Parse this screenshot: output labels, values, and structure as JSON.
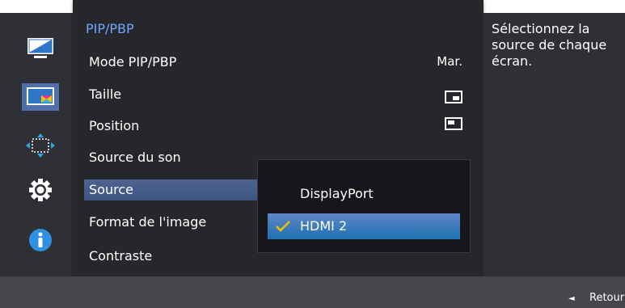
{
  "sidebar": {
    "icons": [
      {
        "name": "monitor-icon"
      },
      {
        "name": "picture-in-picture-icon",
        "selected": true
      },
      {
        "name": "move-arrows-icon"
      },
      {
        "name": "gear-icon"
      },
      {
        "name": "info-icon"
      }
    ]
  },
  "menu": {
    "title": "PIP/PBP",
    "items": [
      {
        "label": "Mode PIP/PBP",
        "value": "Mar."
      },
      {
        "label": "Taille",
        "value_icon": "size-small-icon"
      },
      {
        "label": "Position",
        "value_icon": "position-topleft-icon"
      },
      {
        "label": "Source du son"
      },
      {
        "label": "Source",
        "highlighted": true
      },
      {
        "label": "Format de l'image"
      },
      {
        "label": "Contraste"
      }
    ]
  },
  "dropdown": {
    "options": [
      {
        "label": "DisplayPort"
      },
      {
        "label": "HDMI 2",
        "selected": true
      }
    ]
  },
  "help": {
    "text": "Sélectionnez la source de chaque écran."
  },
  "footer": {
    "back_label": "Retour"
  },
  "colors": {
    "accent_blue": "#6fa6ff",
    "highlight": "#4e6290",
    "check_yellow": "#f2c200",
    "panel": "#26272b"
  }
}
